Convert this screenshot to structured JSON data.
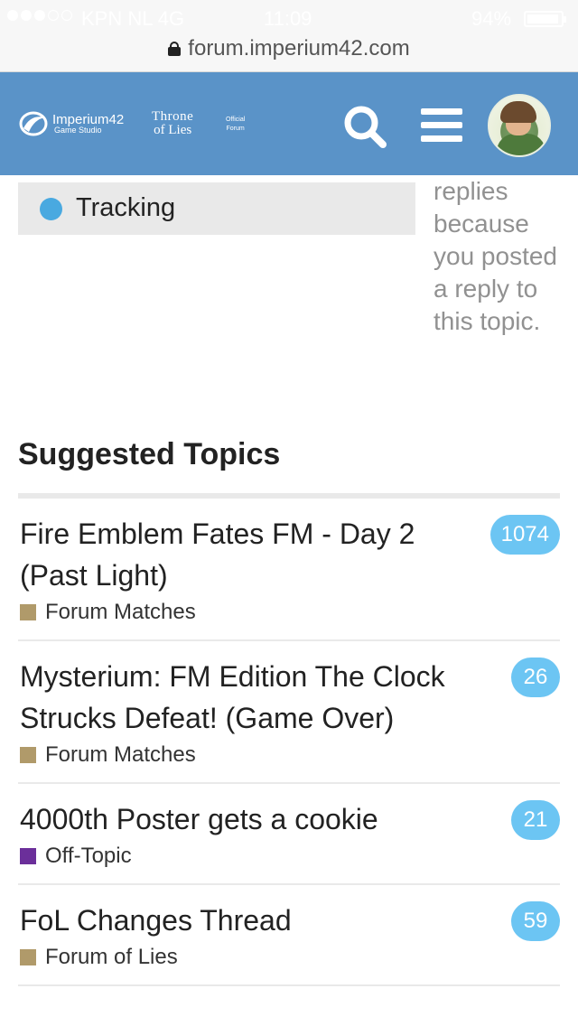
{
  "status_bar": {
    "carrier": "KPN NL  4G",
    "time": "11:09",
    "battery_percent": "94%",
    "battery_level": 0.94,
    "signal_bars_on": 3,
    "signal_bars_total": 5
  },
  "browser": {
    "url": "forum.imperium42.com"
  },
  "header": {
    "logo_name": "Imperium42",
    "logo_sub": "Game Studio",
    "game_title_line1": "Throne",
    "game_title_line2": "of Lies",
    "official_line1": "Official",
    "official_line2": "Forum",
    "background_color": "#5a93c8"
  },
  "tracking": {
    "label": "Tracking",
    "dot_color": "#49a9e0",
    "description": "replies because you posted a reply to this topic."
  },
  "suggested": {
    "title": "Suggested Topics",
    "topics": [
      {
        "title": "Fire Emblem Fates FM - Day 2 (Past Light)",
        "category": "Forum Matches",
        "category_color": "#b09a6a",
        "count": "1074"
      },
      {
        "title": "Mysterium: FM Edition The Clock Strucks Defeat! (Game Over)",
        "category": "Forum Matches",
        "category_color": "#b09a6a",
        "count": "26"
      },
      {
        "title": "4000th Poster gets a cookie",
        "category": "Off-Topic",
        "category_color": "#6b2f9a",
        "count": "21"
      },
      {
        "title": "FoL Changes Thread",
        "category": "Forum of Lies",
        "category_color": "#b09a6a",
        "count": "59"
      }
    ]
  }
}
